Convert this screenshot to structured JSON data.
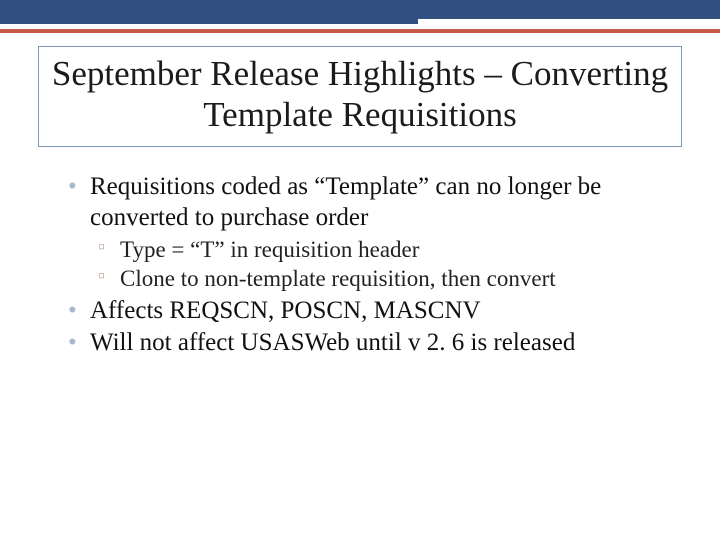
{
  "title": "September Release Highlights – Converting Template Requisitions",
  "bullets": {
    "b0": "Requisitions coded as “Template” can no longer be converted to purchase order",
    "b0_subs": {
      "s0": "Type = “T” in requisition header",
      "s1": "Clone to non-template requisition, then convert"
    },
    "b1": "Affects REQSCN, POSCN, MASCNV",
    "b2": "Will not affect USASWeb until v 2. 6 is released"
  }
}
